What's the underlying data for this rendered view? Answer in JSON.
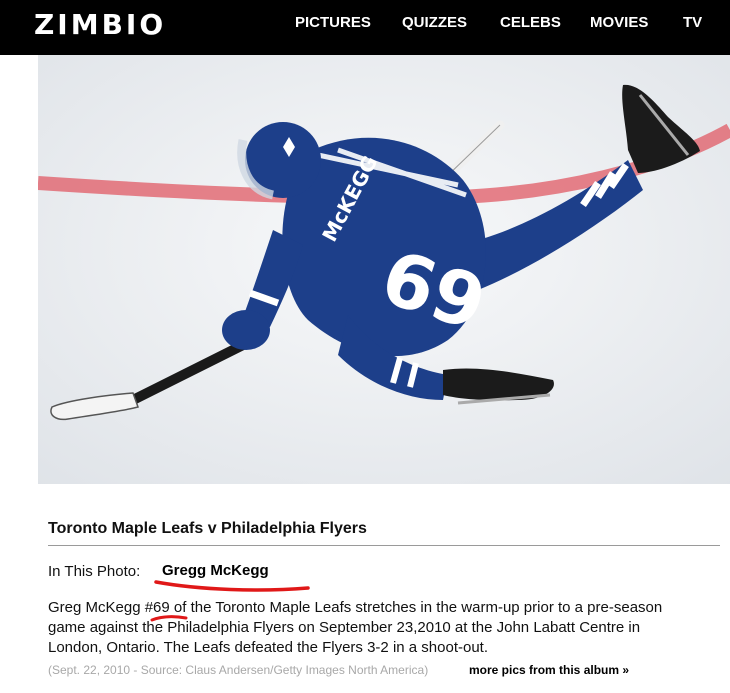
{
  "header": {
    "logo": "ZIMBIO",
    "nav": [
      {
        "label": "PICTURES"
      },
      {
        "label": "QUIZZES"
      },
      {
        "label": "CELEBS"
      },
      {
        "label": "MOVIES"
      },
      {
        "label": "TV"
      }
    ]
  },
  "photo": {
    "jersey_name": "McKEGG",
    "jersey_number": "69"
  },
  "album": {
    "title": "Toronto Maple Leafs v Philadelphia Flyers",
    "in_photo_label": "In This Photo:",
    "person": "Gregg McKegg",
    "caption_lines": [
      "Greg McKegg #69 of the Toronto Maple Leafs stretches in the warm-up prior to a pre-season",
      "game against the Philadelphia Flyers on September 23,2010 at the John Labatt Centre in",
      "London, Ontario. The Leafs defeated the Flyers 3-2 in a shoot-out."
    ],
    "meta": "(Sept. 22, 2010 - Source: Claus Andersen/Getty Images North America)",
    "more_link": "more pics from this album »"
  },
  "colors": {
    "header_bg": "#000000",
    "jersey_blue": "#1d3f8a",
    "annotation_red": "#e01818"
  }
}
